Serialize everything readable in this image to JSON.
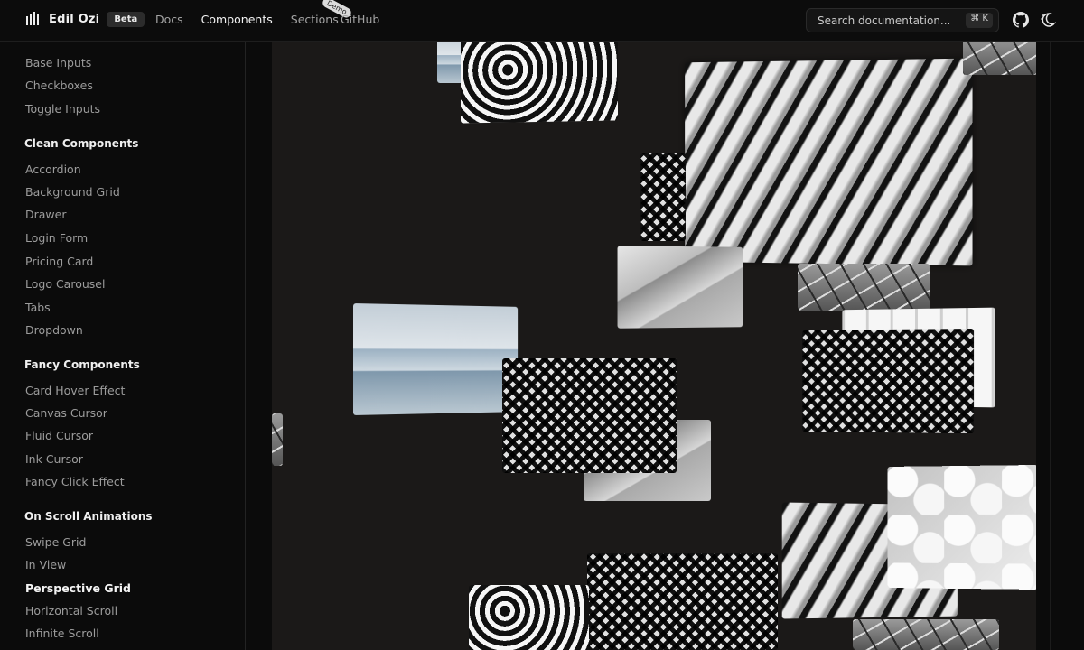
{
  "header": {
    "brand": "Edil Ozi",
    "badge": "Beta",
    "nav": [
      {
        "label": "Docs"
      },
      {
        "label": "Components"
      },
      {
        "label": "Sections"
      },
      {
        "label": "GitHub"
      }
    ],
    "demo_tag": "Demo",
    "search": {
      "placeholder": "Search documentation...",
      "shortcut": "⌘ K"
    },
    "icons": {
      "github": "github-icon",
      "theme": "theme-toggle-icon",
      "logo": "logo-icon"
    }
  },
  "sidebar": {
    "top_items": [
      {
        "label": "Base Inputs"
      },
      {
        "label": "Checkboxes"
      },
      {
        "label": "Toggle Inputs"
      }
    ],
    "clean": {
      "title": "Clean Components",
      "items": [
        {
          "label": "Accordion"
        },
        {
          "label": "Background Grid"
        },
        {
          "label": "Drawer"
        },
        {
          "label": "Login Form"
        },
        {
          "label": "Pricing Card"
        },
        {
          "label": "Logo Carousel"
        },
        {
          "label": "Tabs"
        },
        {
          "label": "Dropdown"
        }
      ]
    },
    "fancy": {
      "title": "Fancy Components",
      "items": [
        {
          "label": "Card Hover Effect"
        },
        {
          "label": "Canvas Cursor"
        },
        {
          "label": "Fluid Cursor"
        },
        {
          "label": "Ink Cursor"
        },
        {
          "label": "Fancy Click Effect"
        }
      ]
    },
    "scroll": {
      "title": "On Scroll Animations",
      "items": [
        {
          "label": "Swipe Grid"
        },
        {
          "label": "In View"
        },
        {
          "label": "Perspective Grid",
          "active": true
        },
        {
          "label": "Horizontal Scroll"
        },
        {
          "label": "Infinite Scroll"
        }
      ]
    }
  },
  "colors": {
    "background": "#0b0b0b",
    "stage": "#1b1918",
    "text_active": "#f4f4f4",
    "text_muted": "#9c9c9c"
  }
}
